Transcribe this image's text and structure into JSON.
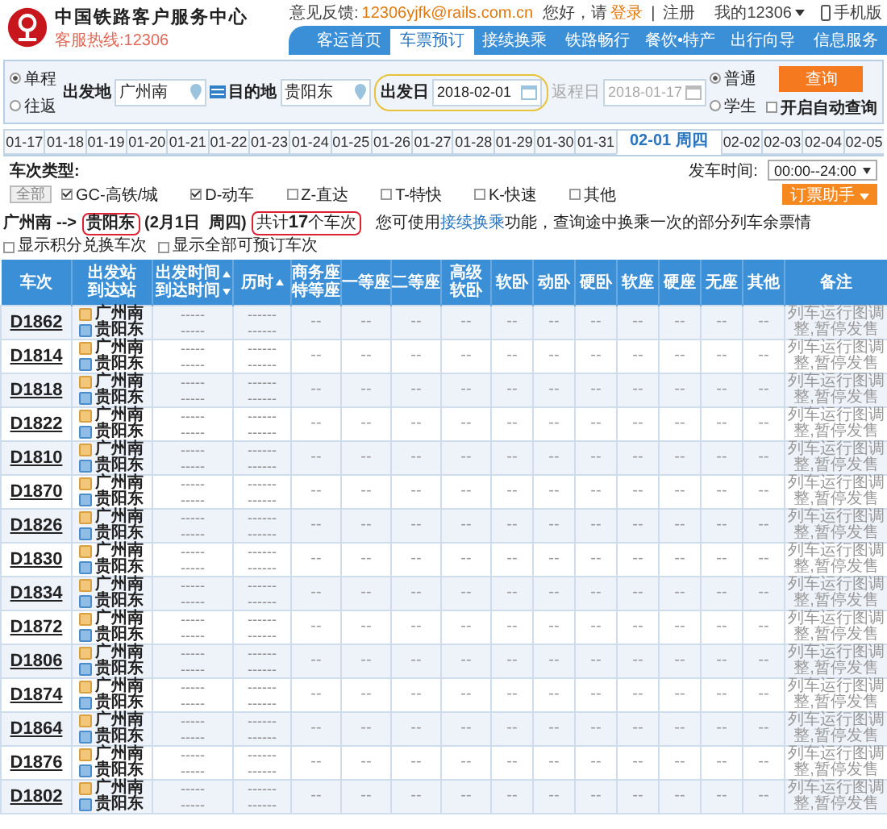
{
  "header": {
    "site_title": "中国铁路客户服务中心",
    "hotline": "客服热线:12306",
    "feedback_label": "意见反馈:",
    "feedback_email": "12306yjfk@rails.com.cn",
    "greeting": "您好，请",
    "login": "登录",
    "separator": "|",
    "register": "注册",
    "my_account": "我的12306",
    "mobile": "手机版"
  },
  "nav": [
    {
      "label": "客运首页",
      "selected": false
    },
    {
      "label": "车票预订",
      "selected": true
    },
    {
      "label": "接续换乘",
      "selected": false
    },
    {
      "label": "铁路畅行",
      "selected": false
    },
    {
      "label": "餐饮•特产",
      "selected": false
    },
    {
      "label": "出行向导",
      "selected": false
    },
    {
      "label": "信息服务",
      "selected": false
    }
  ],
  "search": {
    "trip_types": [
      {
        "label": "单程",
        "selected": true
      },
      {
        "label": "往返",
        "selected": false
      }
    ],
    "from": {
      "label": "出发地",
      "value": "广州南"
    },
    "to": {
      "label": "目的地",
      "value": "贵阳东"
    },
    "depart_date": {
      "label": "出发日",
      "value": "2018-02-01",
      "annotated": true
    },
    "return_date": {
      "label": "返程日",
      "value": "2018-01-17",
      "disabled": true
    },
    "passenger_types": [
      {
        "label": "普通",
        "selected": true
      },
      {
        "label": "学生",
        "selected": false
      }
    ],
    "query_button": "查询",
    "auto_query": {
      "label": "开启自动查询",
      "checked": false
    }
  },
  "date_tabs": [
    {
      "label": "01-17",
      "selected": false
    },
    {
      "label": "01-18",
      "selected": false
    },
    {
      "label": "01-19",
      "selected": false
    },
    {
      "label": "01-20",
      "selected": false
    },
    {
      "label": "01-21",
      "selected": false
    },
    {
      "label": "01-22",
      "selected": false
    },
    {
      "label": "01-23",
      "selected": false
    },
    {
      "label": "01-24",
      "selected": false
    },
    {
      "label": "01-25",
      "selected": false
    },
    {
      "label": "01-26",
      "selected": false
    },
    {
      "label": "01-27",
      "selected": false
    },
    {
      "label": "01-28",
      "selected": false
    },
    {
      "label": "01-29",
      "selected": false
    },
    {
      "label": "01-30",
      "selected": false
    },
    {
      "label": "01-31",
      "selected": false
    },
    {
      "label": "02-01 周四",
      "selected": true
    },
    {
      "label": "02-02",
      "selected": false
    },
    {
      "label": "02-03",
      "selected": false
    },
    {
      "label": "02-04",
      "selected": false
    },
    {
      "label": "02-05",
      "selected": false
    }
  ],
  "filters": {
    "title": "车次类型:",
    "all_button": "全部",
    "types": [
      {
        "label": "GC-高铁/城",
        "checked": true
      },
      {
        "label": "D-动车",
        "checked": true
      },
      {
        "label": "Z-直达",
        "checked": false
      },
      {
        "label": "T-特快",
        "checked": false
      },
      {
        "label": "K-快速",
        "checked": false
      },
      {
        "label": "其他",
        "checked": false
      }
    ],
    "time_label": "发车时间:",
    "time_value": "00:00--24:00",
    "helper_button": "订票助手"
  },
  "summary": {
    "from": "广州南",
    "arrow": "-->",
    "to": "贵阳东",
    "to_annotated": true,
    "date": "(2月1日  周四)",
    "count": "共计**17**个车次",
    "count_annotated": true,
    "hint_before": "您可使用",
    "hint_link": "接续换乘",
    "hint_after": "功能，查询途中换乘一次的部分列车余票情",
    "options": [
      {
        "label": "显示积分兑换车次",
        "checked": false
      },
      {
        "label": "显示全部可预订车次",
        "checked": false
      }
    ]
  },
  "table": {
    "columns": [
      {
        "lines": [
          {
            "text": "车次"
          }
        ]
      },
      {
        "lines": [
          {
            "text": "出发站"
          },
          {
            "text": "到达站"
          }
        ]
      },
      {
        "lines": [
          {
            "text": "出发时间",
            "sort_ascending": true
          },
          {
            "text": "到达时间",
            "sort_ascending": false
          }
        ]
      },
      {
        "lines": [
          {
            "text": "历时",
            "sort_ascending": true
          }
        ]
      },
      {
        "lines": [
          {
            "text": "商务座"
          },
          {
            "text": "特等座"
          }
        ]
      },
      {
        "lines": [
          {
            "text": "一等座"
          }
        ]
      },
      {
        "lines": [
          {
            "text": "二等座"
          }
        ]
      },
      {
        "lines": [
          {
            "text": "高级"
          },
          {
            "text": "软卧"
          }
        ]
      },
      {
        "lines": [
          {
            "text": "软卧"
          }
        ]
      },
      {
        "lines": [
          {
            "text": "动卧"
          }
        ]
      },
      {
        "lines": [
          {
            "text": "硬卧"
          }
        ]
      },
      {
        "lines": [
          {
            "text": "软座"
          }
        ]
      },
      {
        "lines": [
          {
            "text": "硬座"
          }
        ]
      },
      {
        "lines": [
          {
            "text": "无座"
          }
        ]
      },
      {
        "lines": [
          {
            "text": "其他"
          }
        ]
      },
      {
        "lines": [
          {
            "text": "备注"
          }
        ]
      }
    ],
    "rows": [
      {
        "train": "D1862",
        "from": "广州南",
        "to": "贵阳东",
        "depart": "-----",
        "arrive": "-----",
        "duration": "------",
        "duration_note": "------",
        "seats": [
          "--",
          "--",
          "--",
          "--",
          "--",
          "--",
          "--",
          "--",
          "--",
          "--",
          "--"
        ],
        "remark": "列车运行图调整,暂停发售"
      },
      {
        "train": "D1814",
        "from": "广州南",
        "to": "贵阳东",
        "depart": "-----",
        "arrive": "-----",
        "duration": "------",
        "duration_note": "------",
        "seats": [
          "--",
          "--",
          "--",
          "--",
          "--",
          "--",
          "--",
          "--",
          "--",
          "--",
          "--"
        ],
        "remark": "列车运行图调整,暂停发售"
      },
      {
        "train": "D1818",
        "from": "广州南",
        "to": "贵阳东",
        "depart": "-----",
        "arrive": "-----",
        "duration": "------",
        "duration_note": "------",
        "seats": [
          "--",
          "--",
          "--",
          "--",
          "--",
          "--",
          "--",
          "--",
          "--",
          "--",
          "--"
        ],
        "remark": "列车运行图调整,暂停发售"
      },
      {
        "train": "D1822",
        "from": "广州南",
        "to": "贵阳东",
        "depart": "-----",
        "arrive": "-----",
        "duration": "------",
        "duration_note": "------",
        "seats": [
          "--",
          "--",
          "--",
          "--",
          "--",
          "--",
          "--",
          "--",
          "--",
          "--",
          "--"
        ],
        "remark": "列车运行图调整,暂停发售"
      },
      {
        "train": "D1810",
        "from": "广州南",
        "to": "贵阳东",
        "depart": "-----",
        "arrive": "-----",
        "duration": "------",
        "duration_note": "------",
        "seats": [
          "--",
          "--",
          "--",
          "--",
          "--",
          "--",
          "--",
          "--",
          "--",
          "--",
          "--"
        ],
        "remark": "列车运行图调整,暂停发售"
      },
      {
        "train": "D1870",
        "from": "广州南",
        "to": "贵阳东",
        "depart": "-----",
        "arrive": "-----",
        "duration": "------",
        "duration_note": "------",
        "seats": [
          "--",
          "--",
          "--",
          "--",
          "--",
          "--",
          "--",
          "--",
          "--",
          "--",
          "--"
        ],
        "remark": "列车运行图调整,暂停发售"
      },
      {
        "train": "D1826",
        "from": "广州南",
        "to": "贵阳东",
        "depart": "-----",
        "arrive": "-----",
        "duration": "------",
        "duration_note": "------",
        "seats": [
          "--",
          "--",
          "--",
          "--",
          "--",
          "--",
          "--",
          "--",
          "--",
          "--",
          "--"
        ],
        "remark": "列车运行图调整,暂停发售"
      },
      {
        "train": "D1830",
        "from": "广州南",
        "to": "贵阳东",
        "depart": "-----",
        "arrive": "-----",
        "duration": "------",
        "duration_note": "------",
        "seats": [
          "--",
          "--",
          "--",
          "--",
          "--",
          "--",
          "--",
          "--",
          "--",
          "--",
          "--"
        ],
        "remark": "列车运行图调整,暂停发售"
      },
      {
        "train": "D1834",
        "from": "广州南",
        "to": "贵阳东",
        "depart": "-----",
        "arrive": "-----",
        "duration": "------",
        "duration_note": "------",
        "seats": [
          "--",
          "--",
          "--",
          "--",
          "--",
          "--",
          "--",
          "--",
          "--",
          "--",
          "--"
        ],
        "remark": "列车运行图调整,暂停发售"
      },
      {
        "train": "D1872",
        "from": "广州南",
        "to": "贵阳东",
        "depart": "-----",
        "arrive": "-----",
        "duration": "------",
        "duration_note": "------",
        "seats": [
          "--",
          "--",
          "--",
          "--",
          "--",
          "--",
          "--",
          "--",
          "--",
          "--",
          "--"
        ],
        "remark": "列车运行图调整,暂停发售"
      },
      {
        "train": "D1806",
        "from": "广州南",
        "to": "贵阳东",
        "depart": "-----",
        "arrive": "-----",
        "duration": "------",
        "duration_note": "------",
        "seats": [
          "--",
          "--",
          "--",
          "--",
          "--",
          "--",
          "--",
          "--",
          "--",
          "--",
          "--"
        ],
        "remark": "列车运行图调整,暂停发售"
      },
      {
        "train": "D1874",
        "from": "广州南",
        "to": "贵阳东",
        "depart": "-----",
        "arrive": "-----",
        "duration": "------",
        "duration_note": "------",
        "seats": [
          "--",
          "--",
          "--",
          "--",
          "--",
          "--",
          "--",
          "--",
          "--",
          "--",
          "--"
        ],
        "remark": "列车运行图调整,暂停发售"
      },
      {
        "train": "D1864",
        "from": "广州南",
        "to": "贵阳东",
        "depart": "-----",
        "arrive": "-----",
        "duration": "------",
        "duration_note": "------",
        "seats": [
          "--",
          "--",
          "--",
          "--",
          "--",
          "--",
          "--",
          "--",
          "--",
          "--",
          "--"
        ],
        "remark": "列车运行图调整,暂停发售"
      },
      {
        "train": "D1876",
        "from": "广州南",
        "to": "贵阳东",
        "depart": "-----",
        "arrive": "-----",
        "duration": "------",
        "duration_note": "------",
        "seats": [
          "--",
          "--",
          "--",
          "--",
          "--",
          "--",
          "--",
          "--",
          "--",
          "--",
          "--"
        ],
        "remark": "列车运行图调整,暂停发售"
      },
      {
        "train": "D1802",
        "from": "广州南",
        "to": "贵阳东",
        "depart": "-----",
        "arrive": "-----",
        "duration": "------",
        "duration_note": "------",
        "seats": [
          "--",
          "--",
          "--",
          "--",
          "--",
          "--",
          "--",
          "--",
          "--",
          "--",
          "--"
        ],
        "remark": "列车运行图调整,暂停发售"
      }
    ]
  }
}
